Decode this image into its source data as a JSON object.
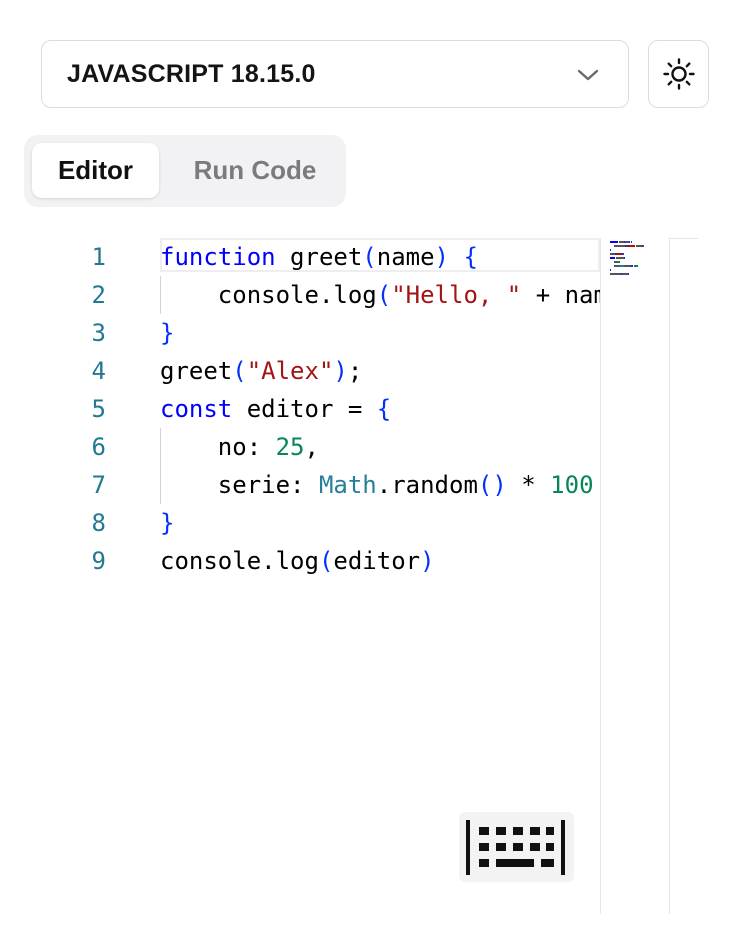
{
  "language_select": {
    "value": "JAVASCRIPT 18.15.0",
    "icon": "chevron-down-icon"
  },
  "theme_toggle": {
    "icon": "sun-icon"
  },
  "tabs": [
    {
      "label": "Editor",
      "active": true
    },
    {
      "label": "Run Code",
      "active": false
    }
  ],
  "editor": {
    "line_numbers": [
      "1",
      "2",
      "3",
      "4",
      "5",
      "6",
      "7",
      "8",
      "9"
    ],
    "lines": [
      [
        {
          "t": "function",
          "c": "kw"
        },
        {
          "t": " greet",
          "c": ""
        },
        {
          "t": "(",
          "c": "br"
        },
        {
          "t": "name",
          "c": ""
        },
        {
          "t": ")",
          "c": "br"
        },
        {
          "t": " ",
          "c": ""
        },
        {
          "t": "{",
          "c": "br"
        }
      ],
      [
        {
          "t": "    console.log",
          "c": ""
        },
        {
          "t": "(",
          "c": "br"
        },
        {
          "t": "\"Hello, \"",
          "c": "str"
        },
        {
          "t": " + name",
          "c": ""
        },
        {
          "t": ")",
          "c": "br"
        },
        {
          "t": ";",
          "c": ""
        }
      ],
      [
        {
          "t": "}",
          "c": "br"
        }
      ],
      [
        {
          "t": "greet",
          "c": ""
        },
        {
          "t": "(",
          "c": "br"
        },
        {
          "t": "\"Alex\"",
          "c": "str"
        },
        {
          "t": ")",
          "c": "br"
        },
        {
          "t": ";",
          "c": ""
        }
      ],
      [
        {
          "t": "const",
          "c": "kw"
        },
        {
          "t": " editor = ",
          "c": ""
        },
        {
          "t": "{",
          "c": "br"
        }
      ],
      [
        {
          "t": "    no: ",
          "c": ""
        },
        {
          "t": "25",
          "c": "num"
        },
        {
          "t": ",",
          "c": ""
        }
      ],
      [
        {
          "t": "    serie: ",
          "c": ""
        },
        {
          "t": "Math",
          "c": "ty"
        },
        {
          "t": ".random",
          "c": ""
        },
        {
          "t": "()",
          "c": "br"
        },
        {
          "t": " * ",
          "c": ""
        },
        {
          "t": "100",
          "c": "num"
        }
      ],
      [
        {
          "t": "}",
          "c": "br"
        }
      ],
      [
        {
          "t": "console.log",
          "c": ""
        },
        {
          "t": "(",
          "c": "br"
        },
        {
          "t": "editor",
          "c": ""
        },
        {
          "t": ")",
          "c": "br"
        }
      ]
    ]
  },
  "keyboard_button": {
    "icon": "keyboard-icon"
  },
  "colors": {
    "keyword": "#0000ff",
    "bracket": "#0431fa",
    "string": "#a31515",
    "number": "#098658",
    "type": "#267f99",
    "line_number": "#237893"
  }
}
